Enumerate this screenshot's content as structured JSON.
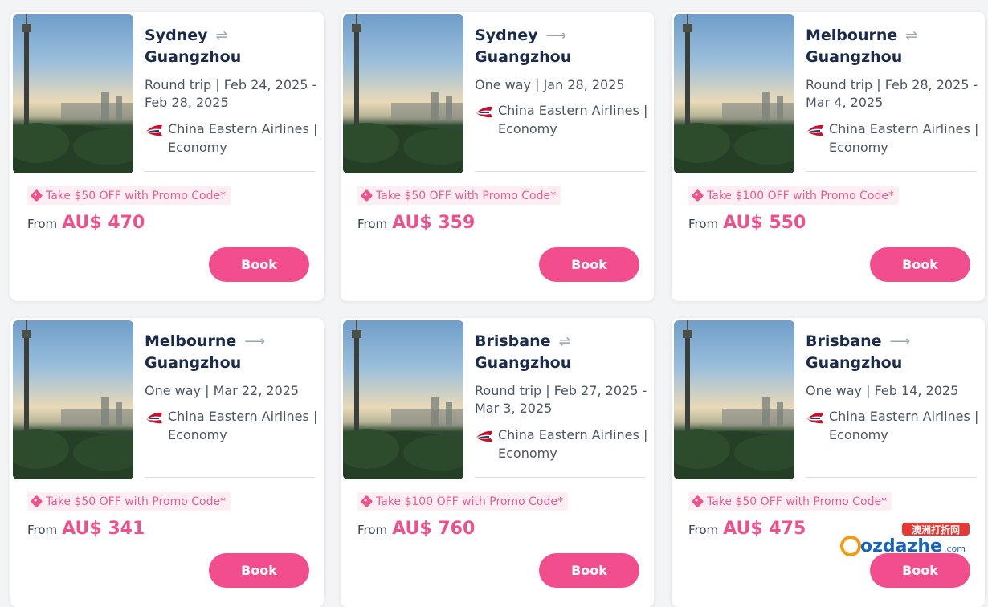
{
  "cards": [
    {
      "from": "Sydney",
      "to": "Guangzhou",
      "arrow": "⇌",
      "trip": "Round trip | Feb 24, 2025 - Feb 28, 2025",
      "airline": "China Eastern Airlines | Economy",
      "promo": "Take $50 OFF with Promo Code*",
      "from_label": "From",
      "price": "AU$ 470",
      "book": "Book"
    },
    {
      "from": "Sydney",
      "to": "Guangzhou",
      "arrow": "⟶",
      "trip": "One way | Jan 28, 2025",
      "airline": "China Eastern Airlines | Economy",
      "promo": "Take $50 OFF with Promo Code*",
      "from_label": "From",
      "price": "AU$ 359",
      "book": "Book"
    },
    {
      "from": "Melbourne",
      "to": "Guangzhou",
      "arrow": "⇌",
      "trip": "Round trip | Feb 28, 2025 - Mar 4, 2025",
      "airline": "China Eastern Airlines | Economy",
      "promo": "Take $100 OFF with Promo Code*",
      "from_label": "From",
      "price": "AU$ 550",
      "book": "Book"
    },
    {
      "from": "Melbourne",
      "to": "Guangzhou",
      "arrow": "⟶",
      "trip": "One way | Mar 22, 2025",
      "airline": "China Eastern Airlines | Economy",
      "promo": "Take $50 OFF with Promo Code*",
      "from_label": "From",
      "price": "AU$ 341",
      "book": "Book"
    },
    {
      "from": "Brisbane",
      "to": "Guangzhou",
      "arrow": "⇌",
      "trip": "Round trip | Feb 27, 2025 - Mar 3, 2025",
      "airline": "China Eastern Airlines | Economy",
      "promo": "Take $100 OFF with Promo Code*",
      "from_label": "From",
      "price": "AU$ 760",
      "book": "Book"
    },
    {
      "from": "Brisbane",
      "to": "Guangzhou",
      "arrow": "⟶",
      "trip": "One way | Feb 14, 2025",
      "airline": "China Eastern Airlines | Economy",
      "promo": "Take $50 OFF with Promo Code*",
      "from_label": "From",
      "price": "AU$ 475",
      "book": "Book"
    }
  ],
  "watermark": {
    "top_text": "澳洲打折网",
    "main_text": "ozdazhe",
    "suffix": ".com"
  },
  "colors": {
    "accent": "#f24e8d",
    "price": "#ef4f8c",
    "promo_bg": "#fdeef3",
    "title": "#1b2b4b"
  }
}
